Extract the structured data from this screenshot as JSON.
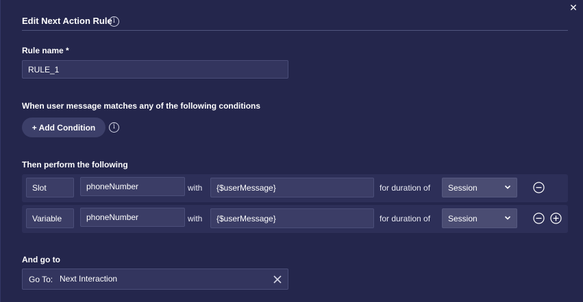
{
  "dialog": {
    "title": "Edit Next Action Rule",
    "close_icon": "close-icon",
    "info_icon": "info-icon"
  },
  "rule_name": {
    "label": "Rule name *",
    "value": "RULE_1"
  },
  "conditions": {
    "heading": "When user message matches any of the following conditions",
    "add_button_label": "+ Add Condition"
  },
  "actions": {
    "heading": "Then perform the following",
    "rows": [
      {
        "type": "Slot",
        "name": "phoneNumber",
        "with_label": "with",
        "value": "{$userMessage}",
        "duration_label": "for duration of",
        "duration": "Session",
        "buttons": [
          "remove-icon"
        ]
      },
      {
        "type": "Variable",
        "name": "phoneNumber",
        "with_label": "with",
        "value": "{$userMessage}",
        "duration_label": "for duration of",
        "duration": "Session",
        "buttons": [
          "remove-icon",
          "add-icon"
        ]
      }
    ]
  },
  "go_to": {
    "heading": "And go to",
    "prefix": "Go To:",
    "value": "Next Interaction"
  },
  "colors": {
    "background": "#24264c",
    "row_background": "#2d2f58",
    "input_background": "#33355e",
    "select_background": "#4a4c72",
    "text": "#ffffff"
  }
}
